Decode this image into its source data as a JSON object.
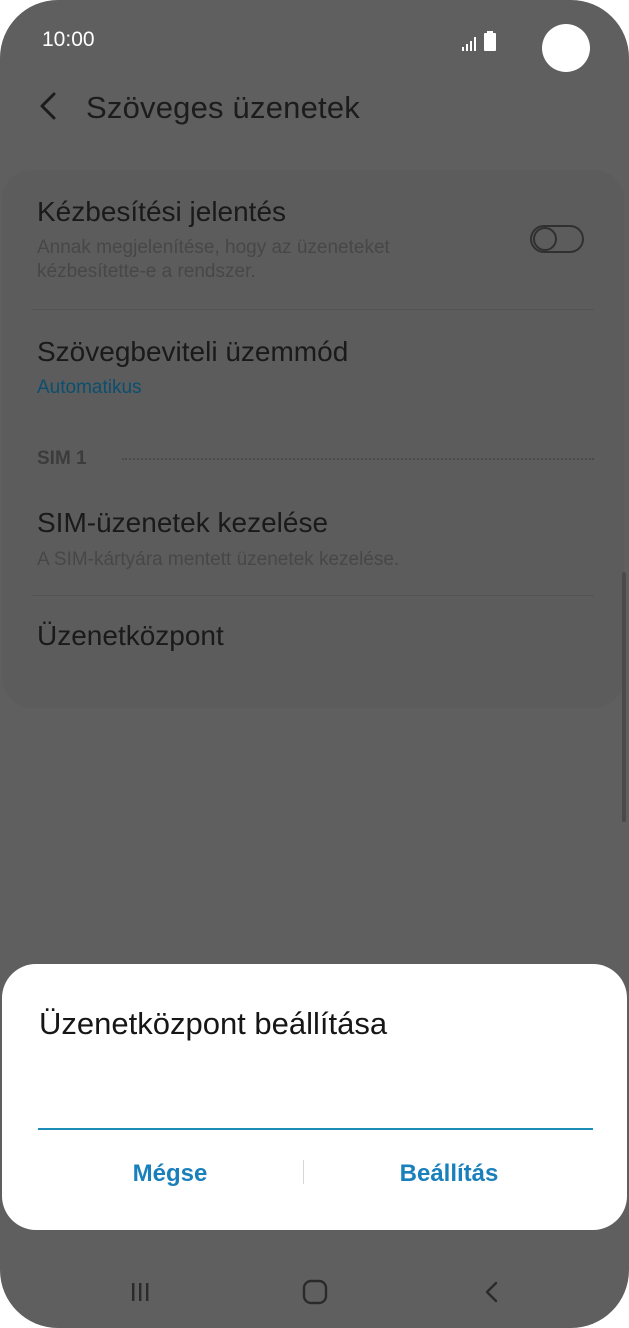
{
  "status_bar": {
    "time": "10:00",
    "signal_icon": "signal-bars-icon",
    "battery_icon": "battery-icon"
  },
  "header": {
    "back_icon": "chevron-left-icon",
    "title": "Szöveges üzenetek"
  },
  "settings": {
    "delivery_report": {
      "title": "Kézbesítési jelentés",
      "description_line1": "Annak megjelenítése, hogy az üzeneteket",
      "description_line2": "kézbesítette-e a rendszer.",
      "toggle_state": "off"
    },
    "input_mode": {
      "title": "Szövegbeviteli üzemmód",
      "value": "Automatikus"
    },
    "section_label": "SIM 1",
    "sim_messages": {
      "title": "SIM-üzenetek kezelése",
      "description": "A SIM-kártyára mentett üzenetek kezelése."
    },
    "message_center": {
      "title": "Üzenetközpont"
    }
  },
  "dialog": {
    "title": "Üzenetközpont beállítása",
    "input_value": "",
    "cancel_label": "Mégse",
    "confirm_label": "Beállítás"
  },
  "nav_bar": {
    "recents_icon": "recents-icon",
    "home_icon": "home-icon",
    "back_icon": "back-icon"
  },
  "colors": {
    "accent": "#1a80bb",
    "input_underline": "#1c8db6",
    "value_text": "#0b4f70",
    "scrim_background": "#5f5f5f"
  }
}
